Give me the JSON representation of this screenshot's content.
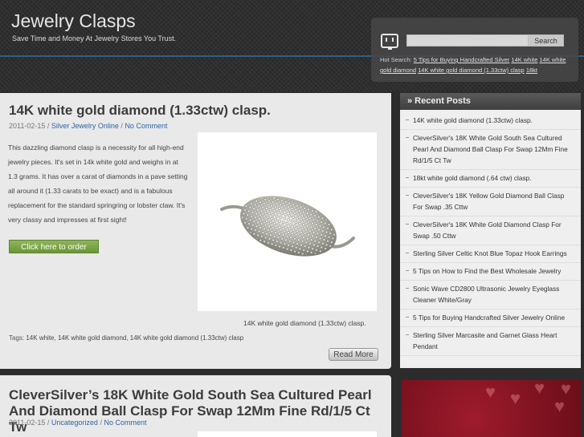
{
  "header": {
    "site_title": "Jewelry Clasps",
    "tagline": "Save Time and Money At Jewelry Stores You Trust."
  },
  "search": {
    "placeholder": "",
    "button_label": "Search",
    "hot_search_label": "Hot Search:",
    "hot_search_links": [
      "5 Tips for Buying Handcrafted Silver",
      "14K white",
      "14K white gold diamond",
      "14K white gold diamond (1.33ctw) clasp",
      "18kt"
    ]
  },
  "posts": [
    {
      "title": "14K white gold diamond (1.33ctw) clasp.",
      "date": "2011-02-15",
      "sep": " / ",
      "category": "Silver Jewelry Online",
      "comments": "No Comment",
      "body": "This dazzling diamond clasp is a necessity for all high-end jewelry pieces. It's set in 14k white gold and weighs in at 1.3 grams. It has over a carat of diamonds in a pave setting all around it (1.33 carats to be exact) and is a fabulous replacement for the standard springring or lobster claw. It's very classy and impresses at first sight!",
      "order_button": "Click here to order",
      "image_caption": "14K white gold diamond (1.33ctw) clasp.",
      "tags_label": "Tags:",
      "tags": [
        "14K white",
        "14K white gold diamond",
        "14K white gold diamond (1.33ctw) clasp"
      ],
      "read_more": "Read More"
    },
    {
      "title": "CleverSilver’s 18K White Gold South Sea Cultured Pearl And Diamond Ball Clasp For Swap 12Mm Fine Rd/1/5 Ct Tw",
      "date": "2011-02-15",
      "sep": " / ",
      "category": "Uncategorized",
      "comments": "No Comment"
    }
  ],
  "sidebar": {
    "title": "» Recent Posts",
    "items": [
      "14K white gold diamond (1.33ctw) clasp.",
      "CleverSilver's 18K White Gold South Sea Cultured Pearl And Diamond Ball Clasp For Swap 12Mm Fine Rd/1/5 Ct Tw",
      "18kt white gold diamond (.64 ctw) clasp.",
      "CleverSilver's 18K Yellow Gold Diamond Ball Clasp For Swap .35 Cttw",
      "CleverSilver's 18K White Gold Diamond Clasp For Swap .50 Cttw",
      "Sterling Silver Celtic Knot Blue Topaz Hook Earrings",
      "5 Tips on How to Find the Best Wholesale Jewelry",
      "Sonic Wave CD2800 Ultrasonic Jewelry Eyeglass Cleaner White/Gray",
      "5 Tips for Buying Handcrafted Silver Jewelry Online",
      "Sterling Silver Marcasite and Garnet Glass Heart Pendant"
    ]
  }
}
